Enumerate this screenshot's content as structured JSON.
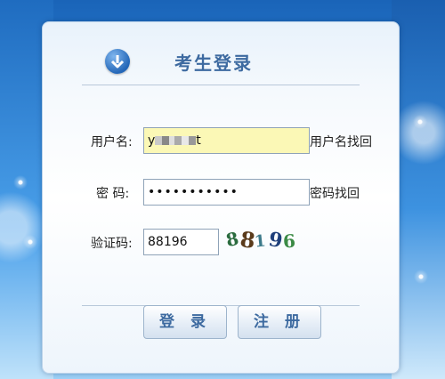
{
  "header": {
    "title": "考生登录",
    "icon": "arrow-down-circle-icon"
  },
  "form": {
    "username": {
      "label": "用户名:",
      "value": "y",
      "value_suffix": "t",
      "link": "用户名找回"
    },
    "password": {
      "label": "密 码:",
      "value": "•••••••••••",
      "link": "密码找回"
    },
    "captcha": {
      "label": "验证码:",
      "value": "88196",
      "image_text": "88196"
    }
  },
  "buttons": {
    "login": "登 录",
    "register": "注 册"
  },
  "colors": {
    "accent": "#3d6aa0",
    "username_field_bg": "#fbf8b6"
  }
}
